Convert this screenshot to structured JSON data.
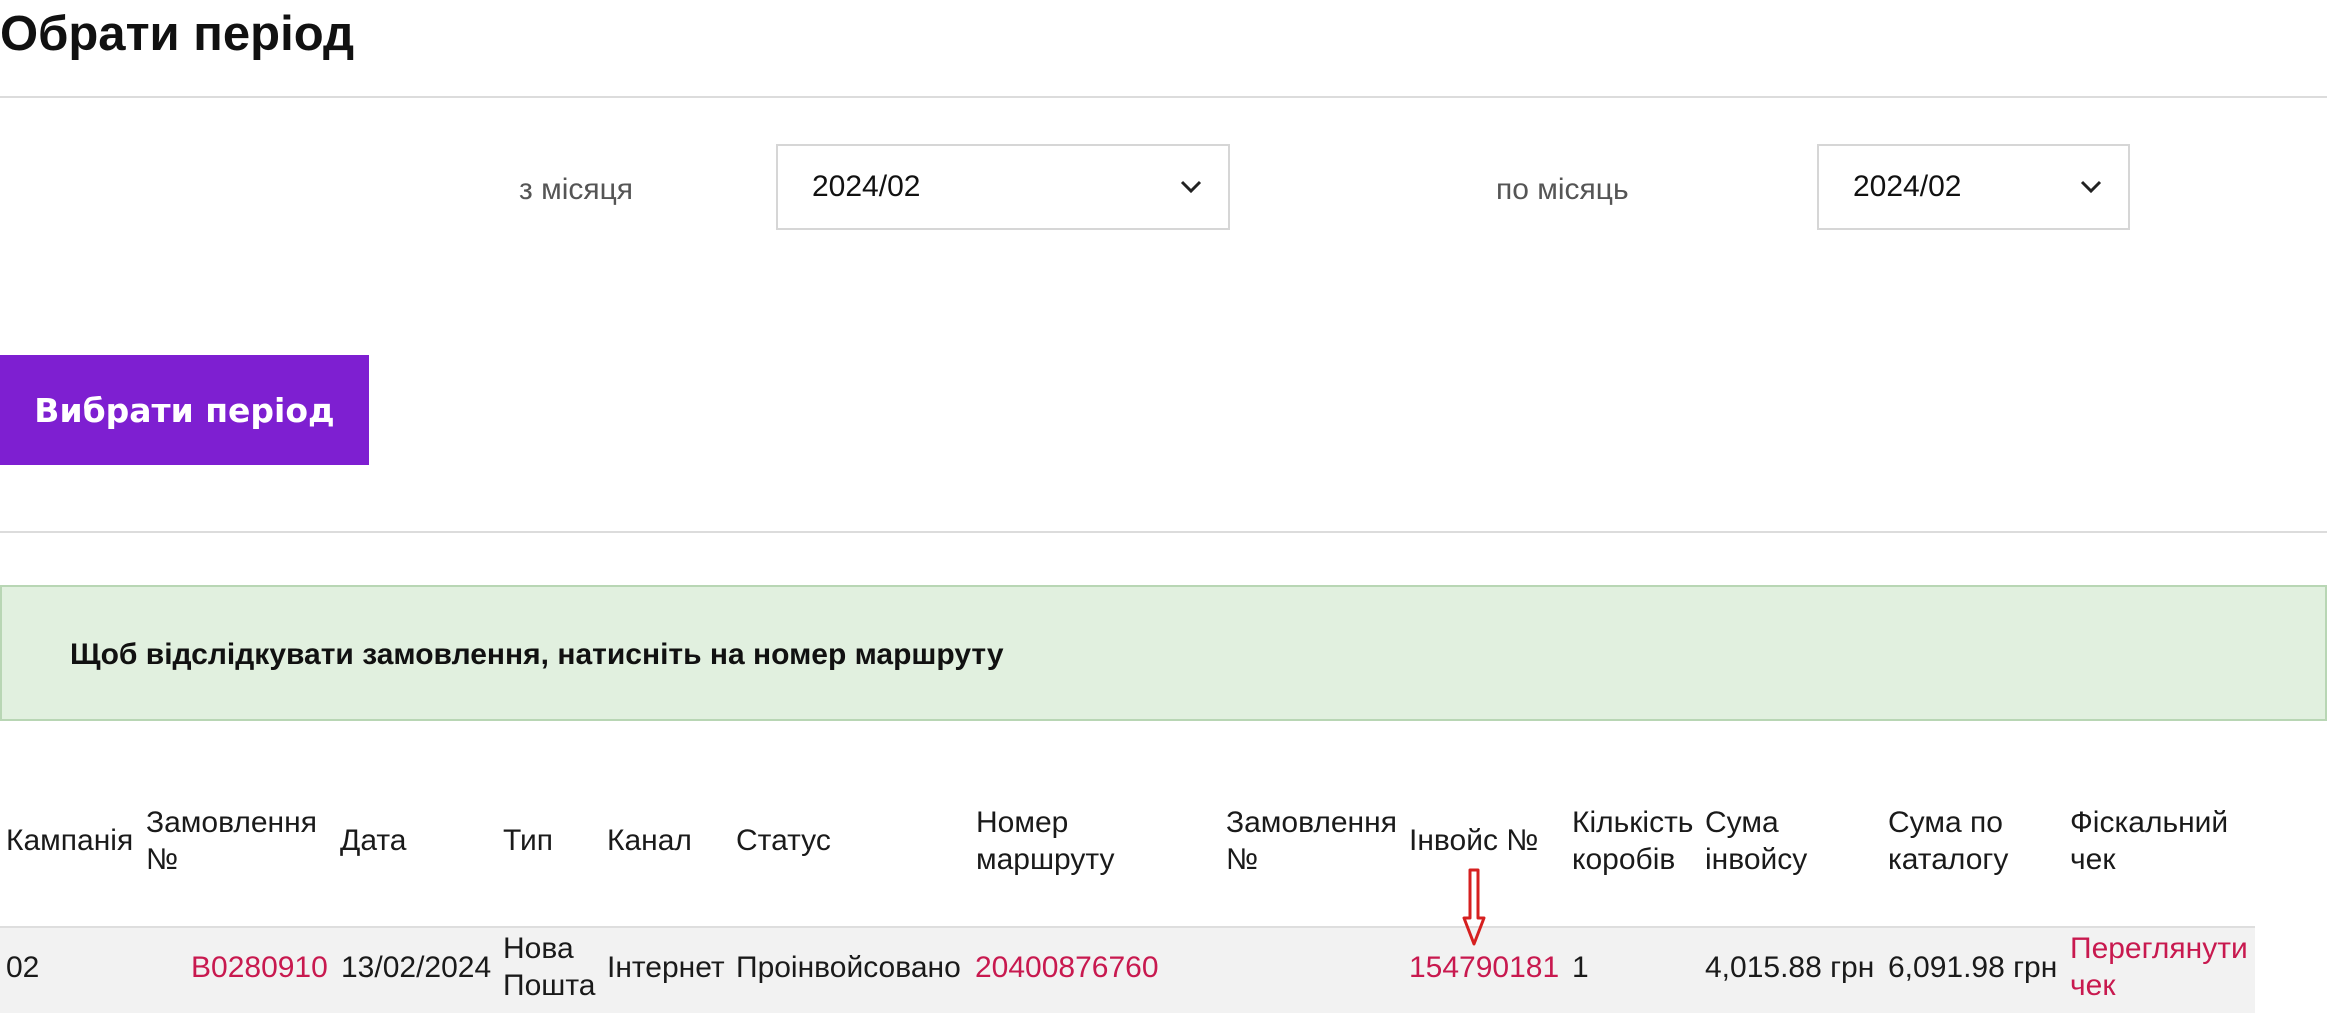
{
  "page": {
    "title": "Обрати період"
  },
  "filters": {
    "from_label": "з місяця",
    "from_value": "2024/02",
    "to_label": "по місяць",
    "to_value": "2024/02",
    "submit_label": "Вибрати період"
  },
  "notice": {
    "text": "Щоб відслідкувати замовлення, натисніть на номер маршруту"
  },
  "table": {
    "headers": {
      "campaign": "Кампанія",
      "order_1a": "Замовлення",
      "order_1b": "№",
      "date": "Дата",
      "type": "Тип",
      "channel": "Канал",
      "status": "Статус",
      "route_a": "Номер",
      "route_b": "маршруту",
      "order_2a": "Замовлення",
      "order_2b": "№",
      "invoice": "Інвойс №",
      "boxes_a": "Кількість",
      "boxes_b": "коробів",
      "inv_sum_a": "Сума",
      "inv_sum_b": "інвойсу",
      "cat_sum_a": "Сума по",
      "cat_sum_b": "каталогу",
      "fiscal_a": "Фіскальний",
      "fiscal_b": "чек"
    },
    "rows": [
      {
        "campaign": "02",
        "order": "B0280910",
        "date": "13/02/2024",
        "type_a": "Нова",
        "type_b": "Пошта",
        "channel": "Інтернет",
        "status": "Проінвойсовано",
        "route": "20400876760",
        "invoice": "154790181",
        "boxes": "1",
        "invoice_sum": "4,015.88 грн",
        "catalog_sum": "6,091.98 грн",
        "fiscal_a": "Переглянути",
        "fiscal_b": "чек"
      }
    ]
  },
  "colors": {
    "accent": "#7e1fd1",
    "link": "#c8194f",
    "notice_bg": "#e1f0df",
    "annotation": "#d62020"
  },
  "icons": {
    "select_chevron": "chevron-down-icon",
    "annotation_arrow": "down-arrow-icon"
  }
}
